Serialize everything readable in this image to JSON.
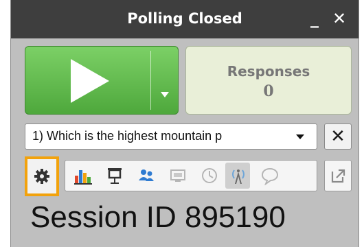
{
  "window": {
    "title": "Polling Closed",
    "minimize_label": "_",
    "close_label": "✕"
  },
  "controls": {
    "play_icon": "play-icon",
    "responses_label": "Responses",
    "responses_count": "0"
  },
  "question": {
    "selected": "1) Which is the highest mountain p",
    "clear_label": "✕"
  },
  "toolbar": {
    "icons": [
      "settings-gear-icon",
      "bar-chart-icon",
      "presenter-screen-icon",
      "participants-icon",
      "screen-share-icon",
      "clock-icon",
      "broadcast-tower-icon",
      "comment-bubble-icon",
      "popout-icon"
    ]
  },
  "session": {
    "text": "Session ID 895190"
  },
  "colors": {
    "play_green": "#5cb84a",
    "responses_bg": "#e9efd8",
    "highlight_orange": "#f2a20c",
    "titlebar": "#3e3e3e",
    "panel_bg": "#bfbfbf"
  }
}
